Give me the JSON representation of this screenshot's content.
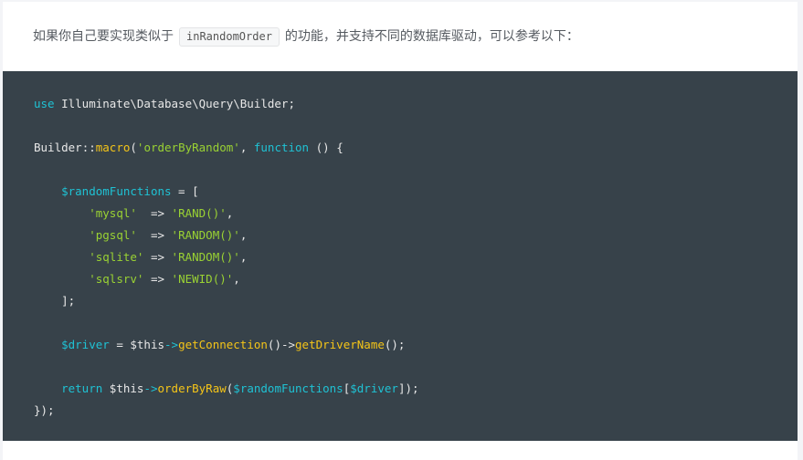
{
  "intro": {
    "before": "如果你自己要实现类似于",
    "inline_code": "inRandomOrder",
    "after": "的功能，并支持不同的数据库驱动，可以参考以下："
  },
  "code": {
    "language": "php",
    "colors": {
      "background": "#37424a",
      "keyword": "#1fc2d4",
      "function": "#f5c518",
      "string": "#9ad233",
      "text": "#e8e8e8"
    },
    "lines": [
      "use Illuminate\\Database\\Query\\Builder;",
      "",
      "Builder::macro('orderByRandom', function () {",
      "",
      "    $randomFunctions = [",
      "        'mysql'  => 'RAND()',",
      "        'pgsql'  => 'RANDOM()',",
      "        'sqlite' => 'RANDOM()',",
      "        'sqlsrv' => 'NEWID()',",
      "    ];",
      "",
      "    $driver = $this->getConnection()->getDriverName();",
      "",
      "    return $this->orderByRaw($randomFunctions[$driver]);",
      "});"
    ]
  }
}
